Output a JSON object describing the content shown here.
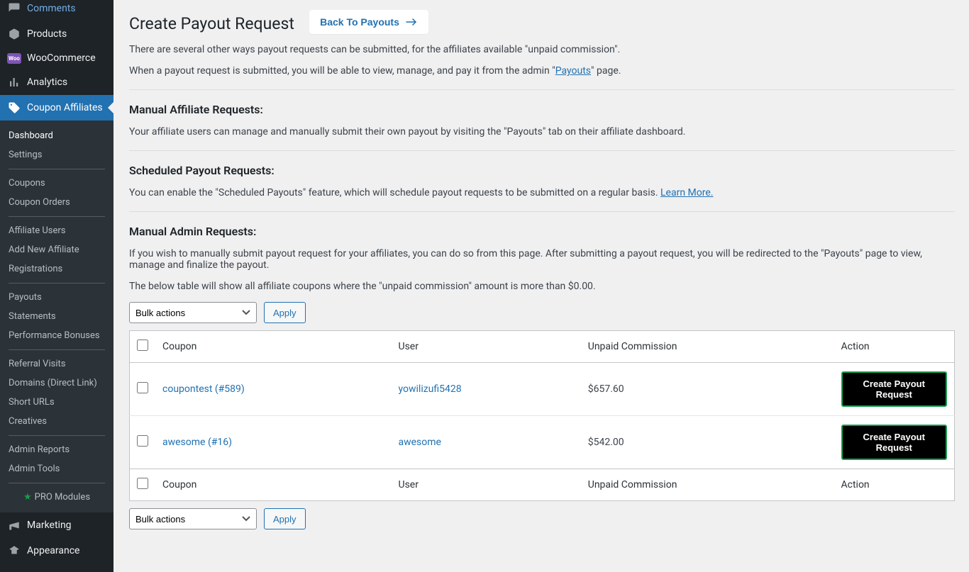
{
  "sidebar": {
    "top": [
      {
        "icon": "comments-icon",
        "label": "Comments"
      },
      {
        "icon": "products-icon",
        "label": "Products"
      },
      {
        "icon": "woocommerce-icon",
        "label": "WooCommerce"
      },
      {
        "icon": "analytics-icon",
        "label": "Analytics"
      },
      {
        "icon": "coupon-affiliates-icon",
        "label": "Coupon Affiliates",
        "active": true
      }
    ],
    "sub": [
      [
        {
          "label": "Dashboard",
          "first": true
        },
        {
          "label": "Settings"
        }
      ],
      [
        {
          "label": "Coupons"
        },
        {
          "label": "Coupon Orders"
        }
      ],
      [
        {
          "label": "Affiliate Users"
        },
        {
          "label": "Add New Affiliate"
        },
        {
          "label": "Registrations"
        }
      ],
      [
        {
          "label": "Payouts"
        },
        {
          "label": "Statements"
        },
        {
          "label": "Performance Bonuses"
        }
      ],
      [
        {
          "label": "Referral Visits"
        },
        {
          "label": "Domains (Direct Link)"
        },
        {
          "label": "Short URLs"
        },
        {
          "label": "Creatives"
        }
      ],
      [
        {
          "label": "Admin Reports"
        },
        {
          "label": "Admin Tools"
        }
      ],
      [
        {
          "label": "PRO Modules",
          "pro": true
        }
      ]
    ],
    "bottom": [
      {
        "icon": "marketing-icon",
        "label": "Marketing"
      },
      {
        "icon": "appearance-icon",
        "label": "Appearance"
      }
    ]
  },
  "header": {
    "title": "Create Payout Request",
    "back_label": "Back To Payouts"
  },
  "intro": {
    "p1": "There are several other ways payout requests can be submitted, for the affiliates available \"unpaid commission\".",
    "p2a": "When a payout request is submitted, you will be able to view, manage, and pay it from the admin \"",
    "p2_link": "Payouts",
    "p2b": "\" page."
  },
  "manual_affiliate": {
    "heading": "Manual Affiliate Requests:",
    "text": "Your affiliate users can manage and manually submit their own payout by visiting the \"Payouts\" tab on their affiliate dashboard."
  },
  "scheduled": {
    "heading": "Scheduled Payout Requests:",
    "text": "You can enable the \"Scheduled Payouts\" feature, which will schedule payout requests to be submitted on a regular basis. ",
    "link": "Learn More."
  },
  "manual_admin": {
    "heading": "Manual Admin Requests:",
    "p1": "If you wish to manually submit payout request for your affiliates, you can do so from this page. After submitting a payout request, you will be redirected to the \"Payouts\" page to view, manage and finalize the payout.",
    "p2": "The below table will show all affiliate coupons where the \"unpaid commission\" amount is more than $0.00."
  },
  "bulk": {
    "select_label": "Bulk actions",
    "apply_label": "Apply"
  },
  "table": {
    "headers": {
      "coupon": "Coupon",
      "user": "User",
      "commission": "Unpaid Commission",
      "action": "Action"
    },
    "action_btn": "Create Payout Request",
    "rows": [
      {
        "coupon": "coupontest (#589)",
        "user": "yowilizufi5428",
        "commission": "$657.60"
      },
      {
        "coupon": "awesome (#16)",
        "user": "awesome",
        "commission": "$542.00"
      }
    ]
  }
}
